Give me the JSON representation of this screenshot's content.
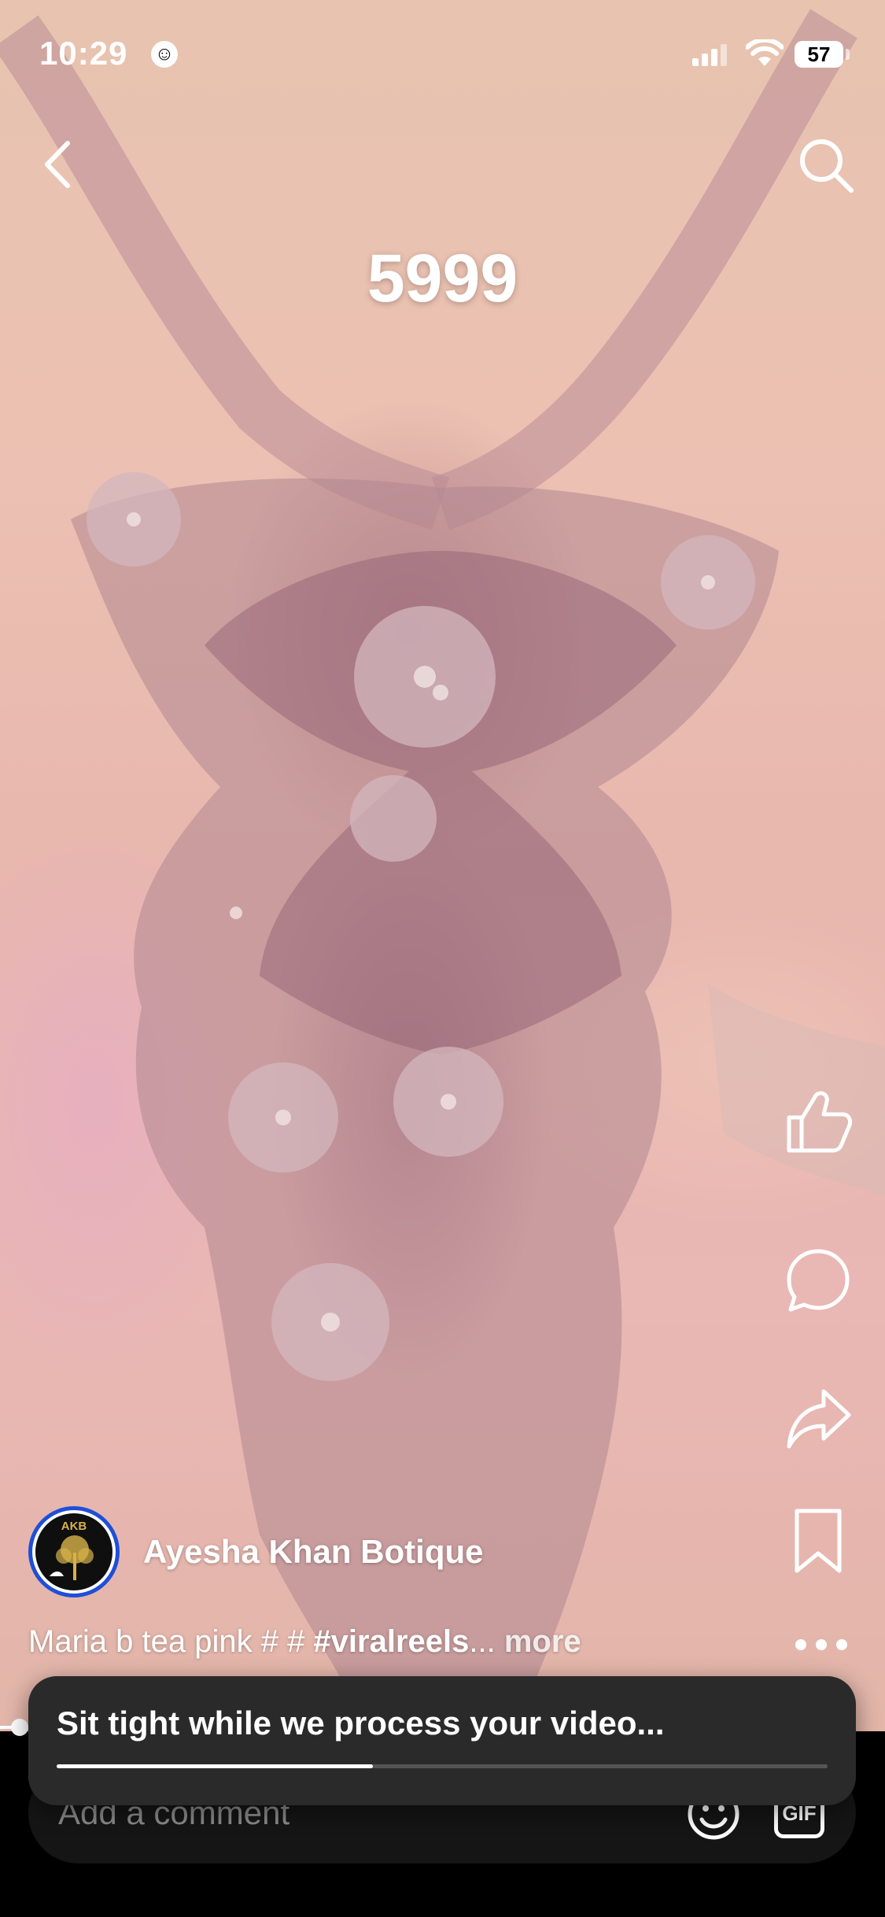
{
  "status": {
    "time": "10:29",
    "battery": "57"
  },
  "reel": {
    "price_overlay": "5999",
    "username": "Ayesha Khan Botique",
    "avatar_initials": "AKB",
    "caption": {
      "text": "Maria b tea pink  # # ",
      "hashtag": "#viralreels",
      "ellipsis": "...",
      "more": " more"
    }
  },
  "icons": {
    "back": "chevron-left-icon",
    "search": "search-icon",
    "like": "thumbs-up-icon",
    "comment": "comment-bubble-icon",
    "share": "share-arrow-icon",
    "save": "bookmark-icon",
    "more": "more-dots-icon"
  },
  "comment_bar": {
    "placeholder": "Add a comment",
    "gif_label": "GIF"
  },
  "toast": {
    "message": "Sit tight while we process your video...",
    "progress": 0.41
  },
  "colors": {
    "avatar_ring": "#1f4fd8",
    "toast_bg": "#2a2a2a",
    "comment_bar_bg": "#151515"
  }
}
